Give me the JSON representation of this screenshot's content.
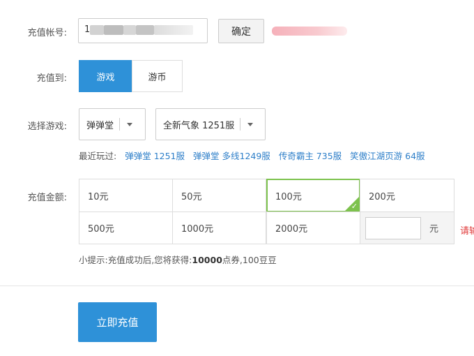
{
  "account": {
    "label": "充值帐号:",
    "value_visible_prefix": "1",
    "confirm_label": "确定"
  },
  "target": {
    "label": "充值到:",
    "options": [
      "游戏",
      "游币"
    ],
    "selected": "游戏"
  },
  "game": {
    "label": "选择游戏:",
    "game_select": "弹弹堂",
    "server_select": "全新气象 1251服"
  },
  "recent": {
    "label": "最近玩过:",
    "items": [
      "弹弹堂 1251服",
      "弹弹堂 多线1249服",
      "传奇霸主 735服",
      "笑傲江湖页游 64服"
    ]
  },
  "amount": {
    "label": "充值金额:",
    "options": [
      "10元",
      "50元",
      "100元",
      "200元",
      "500元",
      "1000元",
      "2000元"
    ],
    "selected": "100元",
    "custom_unit": "元",
    "custom_value": "",
    "side_hint": "请输"
  },
  "tip": {
    "prefix": "小提示:充值成功后,您将获得:",
    "points": "10000",
    "suffix": "点券,100豆豆"
  },
  "submit_label": "立即充值",
  "colors": {
    "primary": "#2e91d8",
    "selected_border": "#7dc24d",
    "link": "#2e7fc9",
    "warning": "#e03a3a"
  }
}
